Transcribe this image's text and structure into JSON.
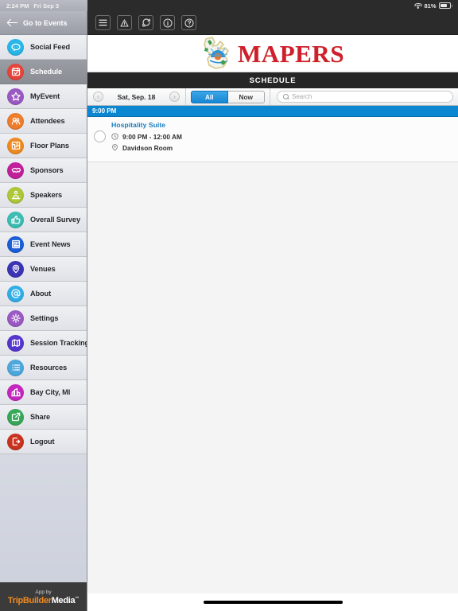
{
  "status_bar": {
    "time": "2:24 PM",
    "date": "Fri Sep 3",
    "battery_percent": "81%",
    "wifi_icon": "wifi-icon",
    "battery_icon": "battery-icon"
  },
  "sidebar": {
    "header": {
      "back_icon": "back-arrow-icon",
      "label": "Go to Events"
    },
    "items": [
      {
        "label": "Social Feed",
        "icon": "social-feed-icon",
        "color": "#29b6e8",
        "active": false
      },
      {
        "label": "Schedule",
        "icon": "calendar-icon",
        "color": "#e8453c",
        "active": true
      },
      {
        "label": "MyEvent",
        "icon": "star-icon",
        "color": "#9b59c4",
        "active": false
      },
      {
        "label": "Attendees",
        "icon": "attendees-icon",
        "color": "#ef7d2b",
        "active": false
      },
      {
        "label": "Floor Plans",
        "icon": "floor-plan-icon",
        "color": "#ef8a22",
        "active": false
      },
      {
        "label": "Sponsors",
        "icon": "handshake-icon",
        "color": "#c2219b",
        "active": false
      },
      {
        "label": "Speakers",
        "icon": "podium-icon",
        "color": "#aec73a",
        "active": false
      },
      {
        "label": "Overall Survey",
        "icon": "thumbs-up-icon",
        "color": "#3dbdb3",
        "active": false
      },
      {
        "label": "Event News",
        "icon": "newspaper-icon",
        "color": "#1c5fd6",
        "active": false
      },
      {
        "label": "Venues",
        "icon": "venue-pin-icon",
        "color": "#3b35b5",
        "active": false
      },
      {
        "label": "About",
        "icon": "at-sign-icon",
        "color": "#31aee8",
        "active": false
      },
      {
        "label": "Settings",
        "icon": "gear-icon",
        "color": "#9b59c4",
        "active": false
      },
      {
        "label": "Session Tracking",
        "icon": "session-tracking-icon",
        "color": "#5536cf",
        "active": false
      },
      {
        "label": "Resources",
        "icon": "list-icon",
        "color": "#4fa8dd",
        "active": false
      },
      {
        "label": "Bay City, MI",
        "icon": "city-icon",
        "color": "#c627bf",
        "active": false
      },
      {
        "label": "Share",
        "icon": "share-icon",
        "color": "#37a85a",
        "active": false
      },
      {
        "label": "Logout",
        "icon": "logout-icon",
        "color": "#c9331f",
        "active": false
      }
    ],
    "footer": {
      "app_by": "App by",
      "brand_first": "TripBuilder",
      "brand_second": "Media",
      "trademark": "™"
    }
  },
  "toolbar": {
    "buttons": [
      {
        "icon": "hamburger-menu-icon",
        "name": "menu-button"
      },
      {
        "icon": "alert-triangle-icon",
        "name": "alerts-button"
      },
      {
        "icon": "refresh-icon",
        "name": "refresh-button"
      },
      {
        "icon": "info-circle-icon",
        "name": "info-button"
      },
      {
        "icon": "help-circle-icon",
        "name": "help-button"
      }
    ]
  },
  "logo_bar": {
    "brand": "MAPERS",
    "state_icon": "michigan-state-icon",
    "brand_color": "#cf1f2e"
  },
  "page_title": "SCHEDULE",
  "filter_bar": {
    "prev_icon": "chevron-left-icon",
    "next_icon": "chevron-right-icon",
    "date": "Sat, Sep. 18",
    "segments": [
      {
        "label": "All",
        "selected": true
      },
      {
        "label": "Now",
        "selected": false
      }
    ],
    "search": {
      "icon": "search-icon",
      "value": "",
      "placeholder": "Search"
    }
  },
  "schedule": {
    "day_header": "9:00 PM",
    "events": [
      {
        "title": "Hospitality Suite",
        "time": "9:00 PM - 12:00 AM",
        "location": "Davidson Room",
        "time_icon": "clock-icon",
        "location_icon": "map-pin-icon",
        "checked": false
      }
    ]
  },
  "home_indicator": "home-indicator"
}
